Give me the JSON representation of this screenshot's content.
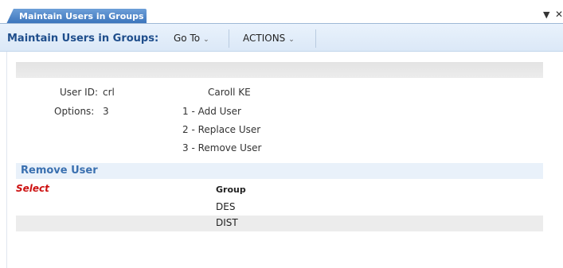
{
  "tab": {
    "label": "Maintain Users in Groups",
    "dropdown_icon": "triangle-down-icon",
    "close_icon": "close-icon"
  },
  "menubar": {
    "title": "Maintain Users in Groups:",
    "goto_label": "Go To",
    "actions_label": "ACTIONS"
  },
  "form": {
    "user_id_label": "User ID:",
    "user_id_value": "crl",
    "user_name": "Caroll KE",
    "options_label": "Options:",
    "options_value": "3",
    "option_items": [
      "1 - Add User",
      "2 - Replace User",
      "3 - Remove User"
    ]
  },
  "section": {
    "title": "Remove User",
    "select_header": "Select",
    "group_header": "Group",
    "rows": [
      {
        "group": "DES"
      },
      {
        "group": "DIST"
      }
    ]
  },
  "colors": {
    "tab_blue": "#3a73bb",
    "menubar_bg": "#dbe8f7",
    "title_blue": "#1f4e8c",
    "section_blue": "#3a70b0",
    "select_red": "#cc1111"
  }
}
